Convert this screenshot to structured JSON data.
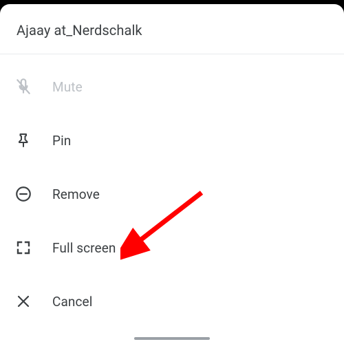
{
  "header": {
    "title": "Ajaay at_Nerdschalk"
  },
  "menu": {
    "mute": {
      "label": "Mute"
    },
    "pin": {
      "label": "Pin"
    },
    "remove": {
      "label": "Remove"
    },
    "fullscreen": {
      "label": "Full screen"
    },
    "cancel": {
      "label": "Cancel"
    }
  },
  "annotation": {
    "color": "#ff0000"
  }
}
